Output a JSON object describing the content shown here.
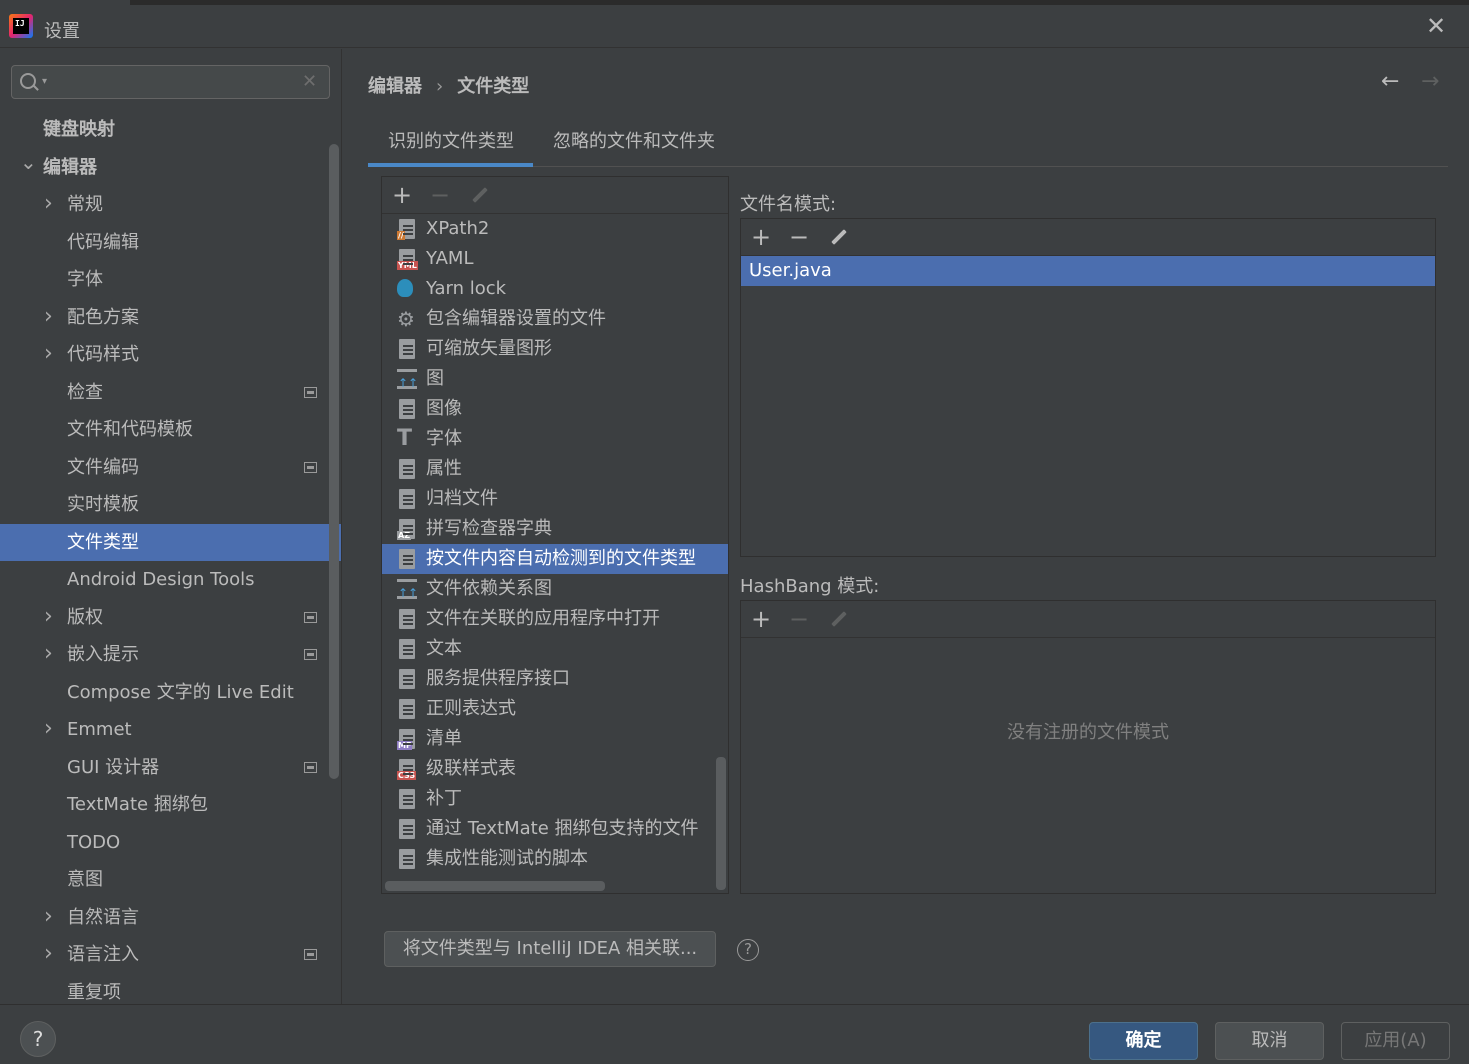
{
  "window": {
    "title": "设置",
    "app_icon_text": "IJ"
  },
  "sidebar": {
    "search_placeholder": "",
    "items": [
      {
        "label": "键盘映射",
        "level": 0,
        "bold": true,
        "chevron": ""
      },
      {
        "label": "编辑器",
        "level": 0,
        "bold": true,
        "chevron": "expanded"
      },
      {
        "label": "常规",
        "level": 1,
        "chevron": "collapsed"
      },
      {
        "label": "代码编辑",
        "level": 1,
        "chevron": ""
      },
      {
        "label": "字体",
        "level": 1,
        "chevron": ""
      },
      {
        "label": "配色方案",
        "level": 1,
        "chevron": "collapsed"
      },
      {
        "label": "代码样式",
        "level": 1,
        "chevron": "collapsed"
      },
      {
        "label": "检查",
        "level": 1,
        "chevron": "",
        "badge": true
      },
      {
        "label": "文件和代码模板",
        "level": 1,
        "chevron": ""
      },
      {
        "label": "文件编码",
        "level": 1,
        "chevron": "",
        "badge": true
      },
      {
        "label": "实时模板",
        "level": 1,
        "chevron": ""
      },
      {
        "label": "文件类型",
        "level": 1,
        "chevron": "",
        "selected": true
      },
      {
        "label": "Android Design Tools",
        "level": 1,
        "chevron": ""
      },
      {
        "label": "版权",
        "level": 1,
        "chevron": "collapsed",
        "badge": true
      },
      {
        "label": "嵌入提示",
        "level": 1,
        "chevron": "collapsed",
        "badge": true
      },
      {
        "label": "Compose 文字的 Live Edit",
        "level": 1,
        "chevron": ""
      },
      {
        "label": "Emmet",
        "level": 1,
        "chevron": "collapsed"
      },
      {
        "label": "GUI 设计器",
        "level": 1,
        "chevron": "",
        "badge": true
      },
      {
        "label": "TextMate 捆绑包",
        "level": 1,
        "chevron": ""
      },
      {
        "label": "TODO",
        "level": 1,
        "chevron": ""
      },
      {
        "label": "意图",
        "level": 1,
        "chevron": ""
      },
      {
        "label": "自然语言",
        "level": 1,
        "chevron": "collapsed"
      },
      {
        "label": "语言注入",
        "level": 1,
        "chevron": "collapsed",
        "badge": true
      },
      {
        "label": "重复项",
        "level": 1,
        "chevron": ""
      }
    ]
  },
  "breadcrumb": {
    "parent": "编辑器",
    "separator": "›",
    "current": "文件类型"
  },
  "nav": {
    "back": "←",
    "forward": "→"
  },
  "tabs": [
    {
      "label": "识别的文件类型",
      "active": true
    },
    {
      "label": "忽略的文件和文件夹",
      "active": false
    }
  ],
  "toolbar_icons": {
    "add": "+",
    "remove": "−",
    "edit": "pencil"
  },
  "file_types": [
    {
      "label": "XPath2",
      "icon": "xpath-file-icon",
      "color": "#cc7832",
      "tag": "//"
    },
    {
      "label": "YAML",
      "icon": "yaml-file-icon",
      "color": "#c75450",
      "tag": "YML"
    },
    {
      "label": "Yarn lock",
      "icon": "yarn-icon",
      "color": "#2c8ebb",
      "tag": ""
    },
    {
      "label": "包含编辑器设置的文件",
      "icon": "gear-icon",
      "color": "#9a9da0",
      "tag": ""
    },
    {
      "label": "可缩放矢量图形",
      "icon": "svg-file-icon",
      "color": "#9a9da0",
      "tag": ""
    },
    {
      "label": "图",
      "icon": "diagram-icon",
      "color": "#9a9da0",
      "tag": ""
    },
    {
      "label": "图像",
      "icon": "image-file-icon",
      "color": "#9a9da0",
      "tag": ""
    },
    {
      "label": "字体",
      "icon": "font-icon",
      "color": "#9a9da0",
      "tag": ""
    },
    {
      "label": "属性",
      "icon": "properties-file-icon",
      "color": "#9a9da0",
      "tag": ""
    },
    {
      "label": "归档文件",
      "icon": "archive-file-icon",
      "color": "#9a9da0",
      "tag": ""
    },
    {
      "label": "拼写检查器字典",
      "icon": "dictionary-file-icon",
      "color": "#9a9da0",
      "tag": "AZ"
    },
    {
      "label": "按文件内容自动检测到的文件类型",
      "icon": "text-file-icon",
      "color": "#9a9da0",
      "tag": "",
      "selected": true
    },
    {
      "label": "文件依赖关系图",
      "icon": "diagram-icon",
      "color": "#9a9da0",
      "tag": ""
    },
    {
      "label": "文件在关联的应用程序中打开",
      "icon": "user-file-icon",
      "color": "#9a9da0",
      "tag": ""
    },
    {
      "label": "文本",
      "icon": "text-file-icon",
      "color": "#9a9da0",
      "tag": ""
    },
    {
      "label": "服务提供程序接口",
      "icon": "text-file-icon",
      "color": "#9a9da0",
      "tag": ""
    },
    {
      "label": "正则表达式",
      "icon": "regex-file-icon",
      "color": "#9a9da0",
      "tag": ""
    },
    {
      "label": "清单",
      "icon": "manifest-file-icon",
      "color": "#8e7cc3",
      "tag": "MF"
    },
    {
      "label": "级联样式表",
      "icon": "css-file-icon",
      "color": "#c75450",
      "tag": "CSS"
    },
    {
      "label": "补丁",
      "icon": "patch-file-icon",
      "color": "#9a9da0",
      "tag": ""
    },
    {
      "label": "通过 TextMate 捆绑包支持的文件",
      "icon": "text-file-icon",
      "color": "#9a9da0",
      "tag": ""
    },
    {
      "label": "集成性能测试的脚本",
      "icon": "text-file-icon",
      "color": "#9a9da0",
      "tag": ""
    }
  ],
  "filename_patterns": {
    "label": "文件名模式:",
    "items": [
      "User.java"
    ]
  },
  "hashbang_patterns": {
    "label": "HashBang 模式:",
    "empty_text": "没有注册的文件模式"
  },
  "associate_button": "将文件类型与 IntelliJ IDEA 相关联...",
  "help_icon": "?",
  "footer": {
    "help": "?",
    "ok": "确定",
    "cancel": "取消",
    "apply": "应用(A)"
  },
  "colors": {
    "accent": "#4b6eaf",
    "background": "#3c3f41",
    "ok_button": "#365880",
    "tab_underline": "#4a88c7"
  }
}
